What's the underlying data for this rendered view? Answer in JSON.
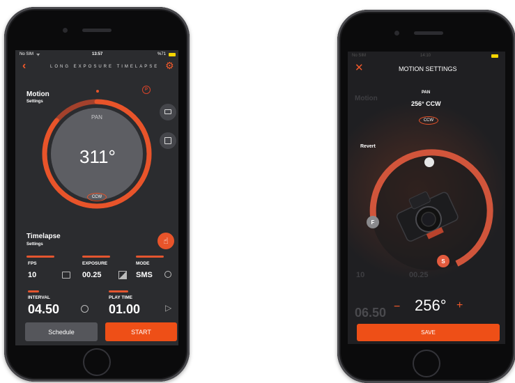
{
  "left_phone": {
    "status": {
      "carrier": "No SIM",
      "time": "13:57",
      "battery": "%71"
    },
    "header_title": "LONG EXPOSURE TIMELAPSE",
    "motion": {
      "title": "Motion",
      "subtitle": "Settings",
      "badge": "P"
    },
    "dial": {
      "axis_label": "PAN",
      "angle": "311°",
      "direction": "CCW",
      "progress": 0.86
    },
    "timelapse": {
      "title": "Timelapse",
      "subtitle": "Settings"
    },
    "fps": {
      "label": "FPS",
      "value": "10"
    },
    "exposure": {
      "label": "EXPOSURE",
      "value": "00.25"
    },
    "mode": {
      "label": "MODE",
      "value": "SMS"
    },
    "interval": {
      "label": "INTERVAL",
      "value": "04.50"
    },
    "play_time": {
      "label": "PLAY TIME",
      "value": "01.00"
    },
    "schedule_label": "Schedule",
    "start_label": "START",
    "accent": "#e8542a"
  },
  "right_phone": {
    "status": {
      "carrier": "No SIM",
      "time": "14:10"
    },
    "header_title": "MOTION SETTINGS",
    "axis_label": "PAN",
    "angle_readout": "256° CCW",
    "direction": "CCW",
    "revert_label": "Revert",
    "handle_f": "F",
    "handle_s": "S",
    "angle_value": "256°",
    "minus": "−",
    "plus": "+",
    "save_label": "SAVE",
    "bg_motion_title": "Motion",
    "bg_interval_value": "06.50",
    "bg_fps_value": "10",
    "bg_exposure_value": "00.25"
  }
}
